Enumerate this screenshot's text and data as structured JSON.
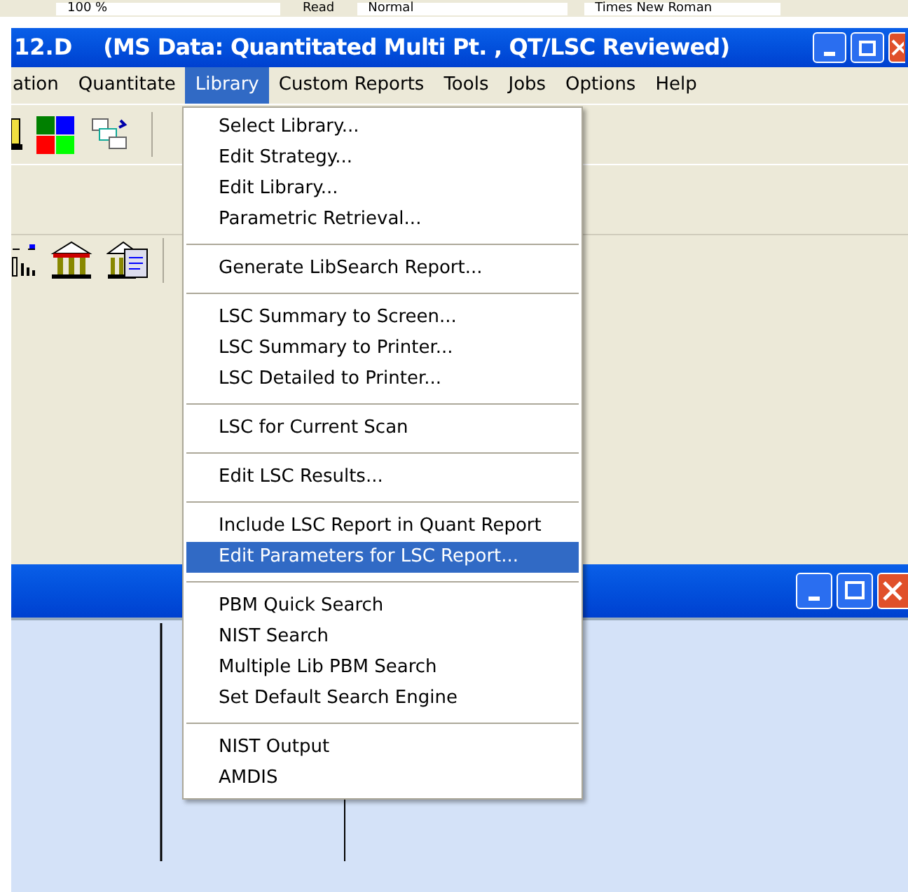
{
  "top_toolbar": {
    "zoom": "100 %",
    "read_button": "Read",
    "style": "Normal",
    "font": "Times New Roman"
  },
  "window": {
    "file": "12.D",
    "title": "(MS Data: Quantitated Multi Pt. , QT/LSC Reviewed)"
  },
  "menu_bar": [
    {
      "label": "ation",
      "selected": false
    },
    {
      "label": "Quantitate",
      "selected": false
    },
    {
      "label": "Library",
      "selected": true
    },
    {
      "label": "Custom Reports",
      "selected": false
    },
    {
      "label": "Tools",
      "selected": false
    },
    {
      "label": "Jobs",
      "selected": false
    },
    {
      "label": "Options",
      "selected": false
    },
    {
      "label": "Help",
      "selected": false
    }
  ],
  "library_menu": [
    [
      {
        "label": "Select Library...",
        "selected": false
      },
      {
        "label": "Edit Strategy...",
        "selected": false
      },
      {
        "label": "Edit Library...",
        "selected": false
      },
      {
        "label": "Parametric Retrieval...",
        "selected": false
      }
    ],
    [
      {
        "label": "Generate LibSearch Report...",
        "selected": false
      }
    ],
    [
      {
        "label": "LSC Summary to Screen...",
        "selected": false
      },
      {
        "label": "LSC Summary to Printer...",
        "selected": false
      },
      {
        "label": "LSC Detailed to Printer...",
        "selected": false
      }
    ],
    [
      {
        "label": "LSC for Current Scan",
        "selected": false
      }
    ],
    [
      {
        "label": "Edit LSC Results...",
        "selected": false
      }
    ],
    [
      {
        "label": "Include LSC Report in Quant Report",
        "selected": false
      },
      {
        "label": "Edit Parameters for LSC Report...",
        "selected": true
      }
    ],
    [
      {
        "label": "PBM Quick Search",
        "selected": false
      },
      {
        "label": "NIST Search",
        "selected": false
      },
      {
        "label": "Multiple Lib PBM Search",
        "selected": false
      },
      {
        "label": "Set Default Search Engine",
        "selected": false
      }
    ],
    [
      {
        "label": "NIST Output",
        "selected": false
      },
      {
        "label": "AMDIS",
        "selected": false
      }
    ]
  ]
}
